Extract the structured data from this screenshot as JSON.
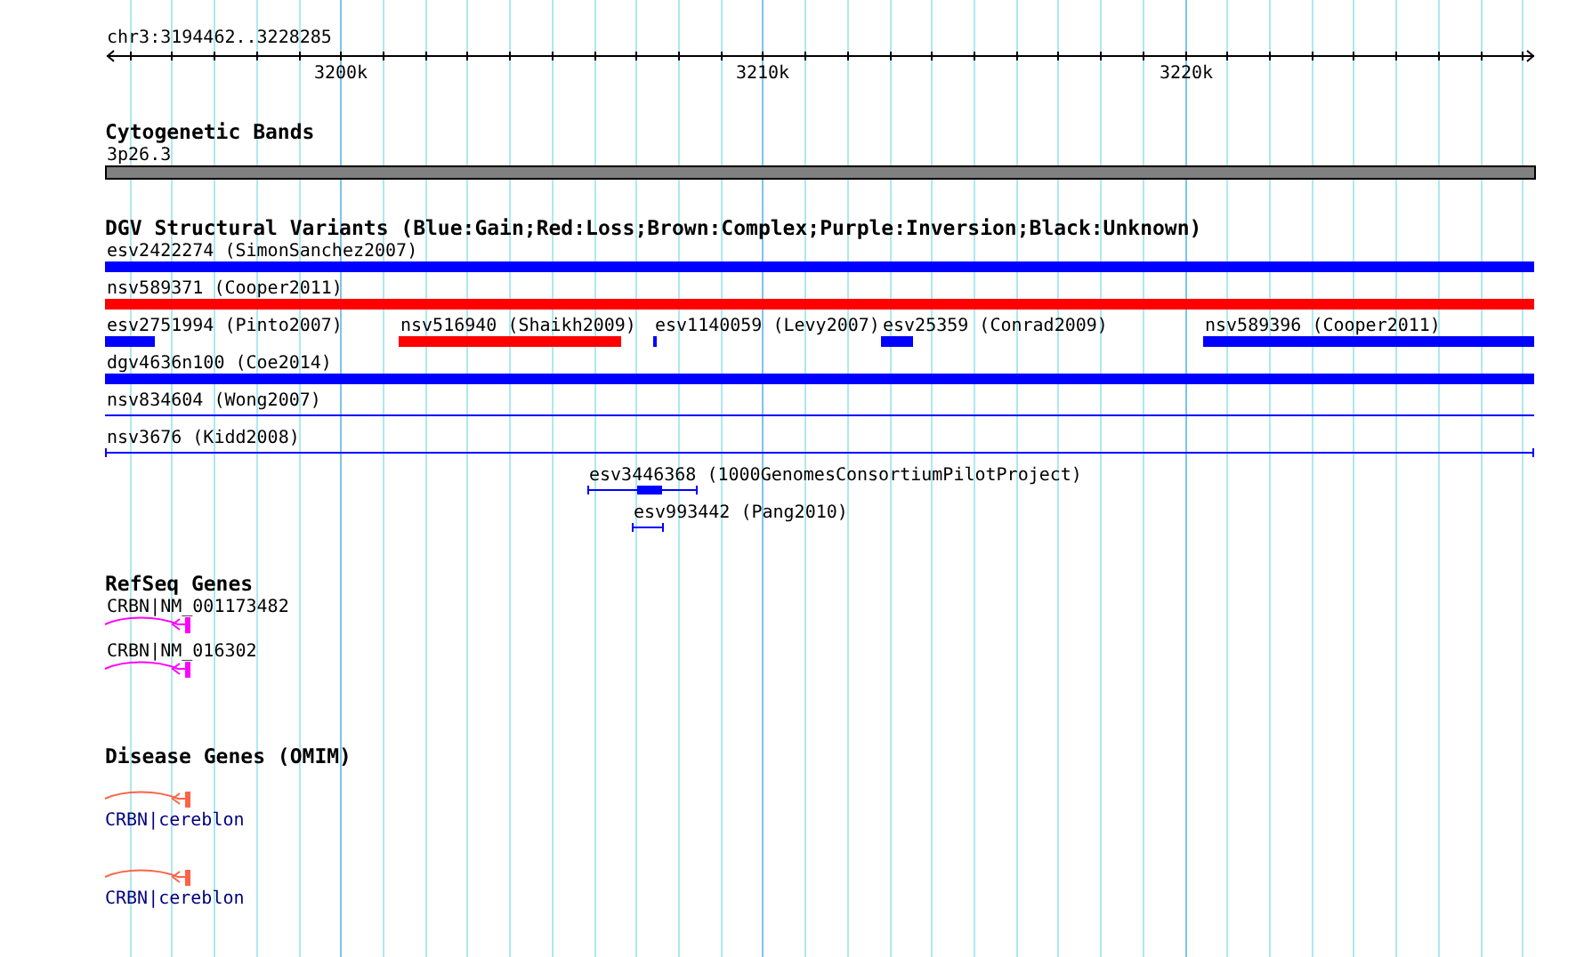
{
  "ruler": {
    "location": "chr3:3194462..3228285",
    "tick_labels": [
      "3200k",
      "3210k",
      "3220k"
    ]
  },
  "tracks": [
    {
      "kind": "bands",
      "title": "Cytogenetic Bands",
      "features": [
        {
          "name": "3p26.3"
        }
      ]
    },
    {
      "kind": "variants",
      "title": "DGV Structural Variants (Blue:Gain;Red:Loss;Brown:Complex;Purple:Inversion;Black:Unknown)",
      "features": [
        {
          "name": "esv2422274 (SimonSanchez2007)",
          "kind": "block",
          "color": "#0000ff"
        },
        {
          "name": "nsv589371 (Cooper2011)",
          "kind": "block",
          "color": "#ff0000"
        },
        {
          "name": "esv2751994 (Pinto2007)",
          "kind": "block",
          "color": "#0000ff"
        },
        {
          "name": "nsv516940 (Shaikh2009)",
          "kind": "block",
          "color": "#ff0000"
        },
        {
          "name": "esv1140059 (Levy2007)",
          "kind": "block",
          "color": "#0000ff"
        },
        {
          "name": "esv25359 (Conrad2009)",
          "kind": "block",
          "color": "#0000ff"
        },
        {
          "name": "nsv589396 (Cooper2011)",
          "kind": "block",
          "color": "#0000ff"
        },
        {
          "name": "dgv4636n100 (Coe2014)",
          "kind": "block",
          "color": "#0000ff"
        },
        {
          "name": "nsv834604 (Wong2007)",
          "kind": "line",
          "color": "#0000ff"
        },
        {
          "name": "nsv3676 (Kidd2008)",
          "kind": "span",
          "color": "#0000ff"
        },
        {
          "name": "esv3446368 (1000GenomesConsortiumPilotProject)",
          "kind": "span_block",
          "color": "#0000ff"
        },
        {
          "name": "esv993442 (Pang2010)",
          "kind": "span",
          "color": "#0000ff"
        }
      ]
    },
    {
      "kind": "genes",
      "title": "RefSeq Genes",
      "features": [
        {
          "name": "CRBN|NM_001173482"
        },
        {
          "name": "CRBN|NM_016302"
        }
      ]
    },
    {
      "kind": "disease_genes",
      "title": "Disease Genes (OMIM)",
      "features": [
        {
          "name": "CRBN|cereblon"
        },
        {
          "name": "CRBN|cereblon"
        }
      ]
    }
  ]
}
